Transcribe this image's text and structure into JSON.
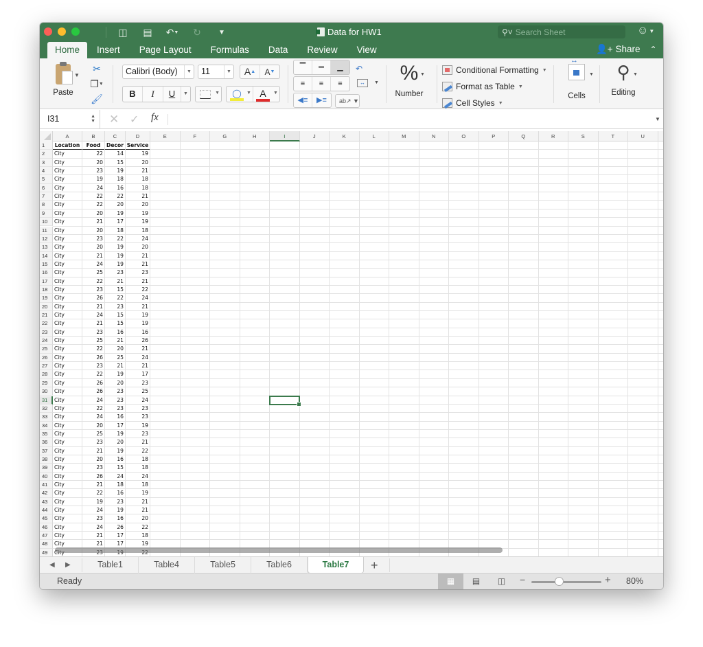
{
  "window": {
    "title": "Data for HW1",
    "search_placeholder": "Search Sheet",
    "share_label": "Share"
  },
  "quick_access": {
    "sidebar_icon": "▯",
    "save_icon": "💾",
    "undo_icon": "↶",
    "redo_icon": "↻",
    "customize_icon": "▾"
  },
  "ribbon_tabs": [
    "Home",
    "Insert",
    "Page Layout",
    "Formulas",
    "Data",
    "Review",
    "View"
  ],
  "ribbon": {
    "paste_label": "Paste",
    "font_name": "Calibri (Body)",
    "font_size": "11",
    "grow_font": "A",
    "shrink_font": "A",
    "bold": "B",
    "italic": "I",
    "underline": "U",
    "font_color_glyph": "A",
    "number_glyph": "%",
    "number_label": "Number",
    "conditional_formatting": "Conditional Formatting",
    "format_as_table": "Format as Table",
    "cell_styles": "Cell Styles",
    "cells_label": "Cells",
    "editing_label": "Editing"
  },
  "formula_bar": {
    "name_box": "I31",
    "fx_label": "fx",
    "formula_value": ""
  },
  "sheet": {
    "columns": [
      "A",
      "B",
      "C",
      "D",
      "E",
      "F",
      "G",
      "H",
      "I",
      "J",
      "K",
      "L",
      "M",
      "N",
      "O",
      "P",
      "Q",
      "R",
      "S",
      "T",
      "U"
    ],
    "selected_column": "I",
    "selected_row": 31,
    "header_row": [
      "Location",
      "Food",
      "Decor",
      "Service"
    ],
    "rows": [
      [
        "City",
        22,
        14,
        19
      ],
      [
        "City",
        20,
        15,
        20
      ],
      [
        "City",
        23,
        19,
        21
      ],
      [
        "City",
        19,
        18,
        18
      ],
      [
        "City",
        24,
        16,
        18
      ],
      [
        "City",
        22,
        22,
        21
      ],
      [
        "City",
        22,
        20,
        20
      ],
      [
        "City",
        20,
        19,
        19
      ],
      [
        "City",
        21,
        17,
        19
      ],
      [
        "City",
        20,
        18,
        18
      ],
      [
        "City",
        23,
        22,
        24
      ],
      [
        "City",
        20,
        19,
        20
      ],
      [
        "City",
        21,
        19,
        21
      ],
      [
        "City",
        24,
        19,
        21
      ],
      [
        "City",
        25,
        23,
        23
      ],
      [
        "City",
        22,
        21,
        21
      ],
      [
        "City",
        23,
        15,
        22
      ],
      [
        "City",
        26,
        22,
        24
      ],
      [
        "City",
        21,
        23,
        21
      ],
      [
        "City",
        24,
        15,
        19
      ],
      [
        "City",
        21,
        15,
        19
      ],
      [
        "City",
        23,
        16,
        16
      ],
      [
        "City",
        25,
        21,
        26
      ],
      [
        "City",
        22,
        20,
        21
      ],
      [
        "City",
        26,
        25,
        24
      ],
      [
        "City",
        23,
        21,
        21
      ],
      [
        "City",
        22,
        19,
        17
      ],
      [
        "City",
        26,
        20,
        23
      ],
      [
        "City",
        26,
        23,
        25
      ],
      [
        "City",
        24,
        23,
        24
      ],
      [
        "City",
        22,
        23,
        23
      ],
      [
        "City",
        24,
        16,
        23
      ],
      [
        "City",
        20,
        17,
        19
      ],
      [
        "City",
        25,
        19,
        23
      ],
      [
        "City",
        23,
        20,
        21
      ],
      [
        "City",
        21,
        19,
        22
      ],
      [
        "City",
        20,
        16,
        18
      ],
      [
        "City",
        23,
        15,
        18
      ],
      [
        "City",
        26,
        24,
        24
      ],
      [
        "City",
        21,
        18,
        18
      ],
      [
        "City",
        22,
        16,
        19
      ],
      [
        "City",
        19,
        23,
        21
      ],
      [
        "City",
        24,
        19,
        21
      ],
      [
        "City",
        23,
        16,
        20
      ],
      [
        "City",
        24,
        26,
        22
      ],
      [
        "City",
        21,
        17,
        18
      ],
      [
        "City",
        21,
        17,
        19
      ],
      [
        "City",
        23,
        19,
        22
      ]
    ]
  },
  "sheet_tabs": [
    "Table1",
    "Table4",
    "Table5",
    "Table6",
    "Table7"
  ],
  "active_sheet": "Table7",
  "status": {
    "ready": "Ready",
    "zoom": "80%",
    "zoom_level_percent": 80
  },
  "colors": {
    "brand_green": "#3e7a4f",
    "selection_green": "#3b7a4c"
  }
}
